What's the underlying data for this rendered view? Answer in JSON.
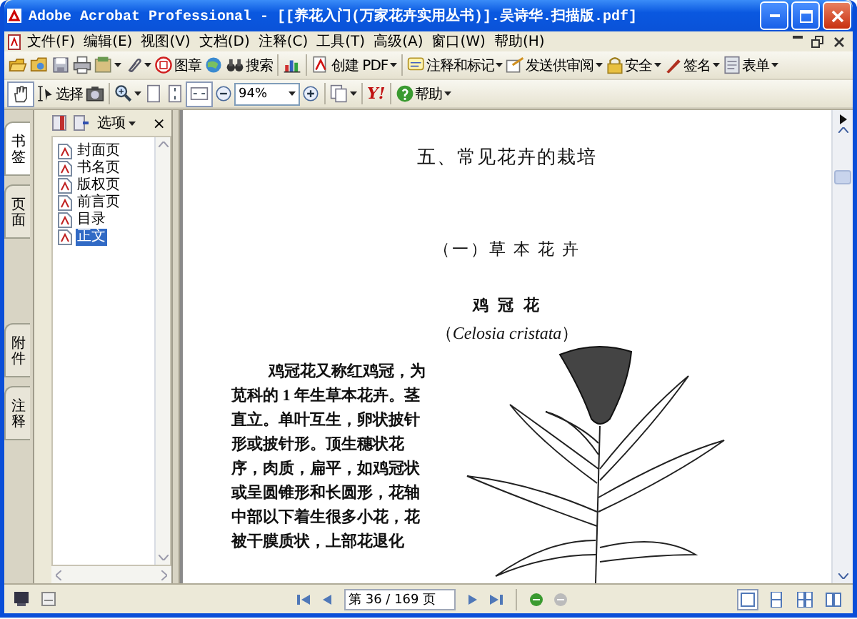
{
  "window": {
    "title": "Adobe Acrobat Professional - [[养花入门(万家花卉实用丛书)].吴诗华.扫描版.pdf]"
  },
  "menu": [
    "文件(F)",
    "编辑(E)",
    "视图(V)",
    "文档(D)",
    "注释(C)",
    "工具(T)",
    "高级(A)",
    "窗口(W)",
    "帮助(H)"
  ],
  "toolbar_1": [
    {
      "kind": "tool",
      "dropdown": false
    },
    {
      "kind": "tool",
      "dropdown": false
    },
    {
      "kind": "tool",
      "dropdown": false
    },
    {
      "kind": "tool",
      "dropdown": false
    },
    {
      "kind": "tool",
      "dropdown": true
    },
    {
      "kind": "tool",
      "dropdown": true
    },
    {
      "kind": "labeled",
      "label": "图章",
      "dropdown": false
    },
    {
      "kind": "tool",
      "dropdown": false
    },
    {
      "kind": "labeled",
      "label": "搜索",
      "dropdown": false
    },
    {
      "kind": "separator"
    },
    {
      "kind": "tool",
      "dropdown": false
    },
    {
      "kind": "separator"
    },
    {
      "kind": "labeled",
      "label": "创建 PDF",
      "dropdown": true
    },
    {
      "kind": "separator"
    },
    {
      "kind": "labeled",
      "label": "注释和标记",
      "dropdown": true
    },
    {
      "kind": "labeled",
      "label": "发送供审阅",
      "dropdown": true
    },
    {
      "kind": "labeled",
      "label": "安全",
      "dropdown": true
    },
    {
      "kind": "labeled",
      "label": "签名",
      "dropdown": true
    },
    {
      "kind": "labeled",
      "label": "表单",
      "dropdown": true
    }
  ],
  "toolbar_2": [
    {
      "kind": "tool",
      "dropdown": false,
      "pressed": true
    },
    {
      "kind": "labeled",
      "label": "选择",
      "dropdown": false,
      "pressed": false
    },
    {
      "kind": "tool",
      "dropdown": false,
      "pressed": false
    },
    {
      "kind": "separator"
    },
    {
      "kind": "tool",
      "dropdown": true,
      "pressed": false
    },
    {
      "kind": "tool",
      "dropdown": false,
      "pressed": false
    },
    {
      "kind": "tool",
      "dropdown": false,
      "pressed": false
    },
    {
      "kind": "tool",
      "dropdown": false,
      "pressed": true
    },
    {
      "kind": "tool",
      "dropdown": false,
      "pressed": false
    },
    {
      "kind": "zoom",
      "value": "94%"
    },
    {
      "kind": "tool",
      "dropdown": false,
      "pressed": false
    },
    {
      "kind": "separator"
    },
    {
      "kind": "tool",
      "dropdown": true,
      "pressed": false
    },
    {
      "kind": "separator"
    },
    {
      "kind": "glyph",
      "label": "Y!",
      "dropdown": false,
      "pressed": false
    },
    {
      "kind": "separator"
    },
    {
      "kind": "labeled",
      "label": "帮助",
      "dropdown": true,
      "pressed": false
    }
  ],
  "side_tabs_top": [
    {
      "label": "书签",
      "selected": true
    },
    {
      "label": "页面",
      "selected": false
    }
  ],
  "side_tabs_bottom": [
    {
      "label": "附件",
      "selected": false
    },
    {
      "label": "注释",
      "selected": false
    }
  ],
  "nav_pane": {
    "options": "选项",
    "close": "×",
    "bookmarks": [
      {
        "label": "封面页",
        "selected": false
      },
      {
        "label": "书名页",
        "selected": false
      },
      {
        "label": "版权页",
        "selected": false
      },
      {
        "label": "前言页",
        "selected": false
      },
      {
        "label": "目录",
        "selected": false
      },
      {
        "label": "正文",
        "selected": true
      }
    ]
  },
  "document": {
    "heading": "五、常见花卉的栽培",
    "subheading": "（一）草 本 花 卉",
    "plant_name": "鸡 冠 花",
    "latin_name": "（*Celosia cristata*）",
    "paragraph_lines": [
      "鸡冠花又称红鸡冠，为",
      "苋科的 1 年生草本花卉。茎",
      "直立。单叶互生，卵状披针",
      "形或披针形。顶生穗状花",
      "序，肉质，扁平，如鸡冠状",
      "或呈圆锥形和长圆形，花轴",
      "中部以下着生很多小花，花",
      "被干膜质状，上部花退化"
    ]
  },
  "status_bar": {
    "page_field": "第 36 / 169 页"
  }
}
